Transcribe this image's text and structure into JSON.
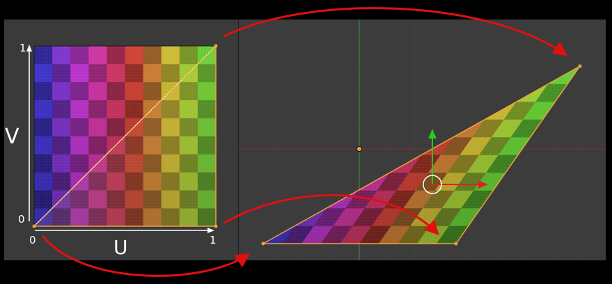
{
  "uv_editor": {
    "axis_u_label": "U",
    "axis_v_label": "V",
    "u_origin_tick": "0",
    "u_max_tick": "1",
    "v_origin_tick": "0",
    "v_max_tick": "1",
    "grid_columns": 10,
    "grid_rows": 10
  },
  "colors": {
    "outer_frame": "#000000",
    "panel_background": "#3a3a3a",
    "viewport_background": "#3c3c3c",
    "grid_line": "#454545",
    "selection_edge": "#f0a23a",
    "arrow": "#e01010",
    "y_axis_line": "#3f8f3f",
    "x_axis_line": "#7a3030",
    "gizmo_up_arrow": "#22cc22",
    "gizmo_right_arrow": "#dd2222",
    "gizmo_ring": "#ffffff"
  },
  "icons": {
    "object_origin": "orange-dot-icon",
    "transform_gizmo": "move-gizmo-icon"
  }
}
